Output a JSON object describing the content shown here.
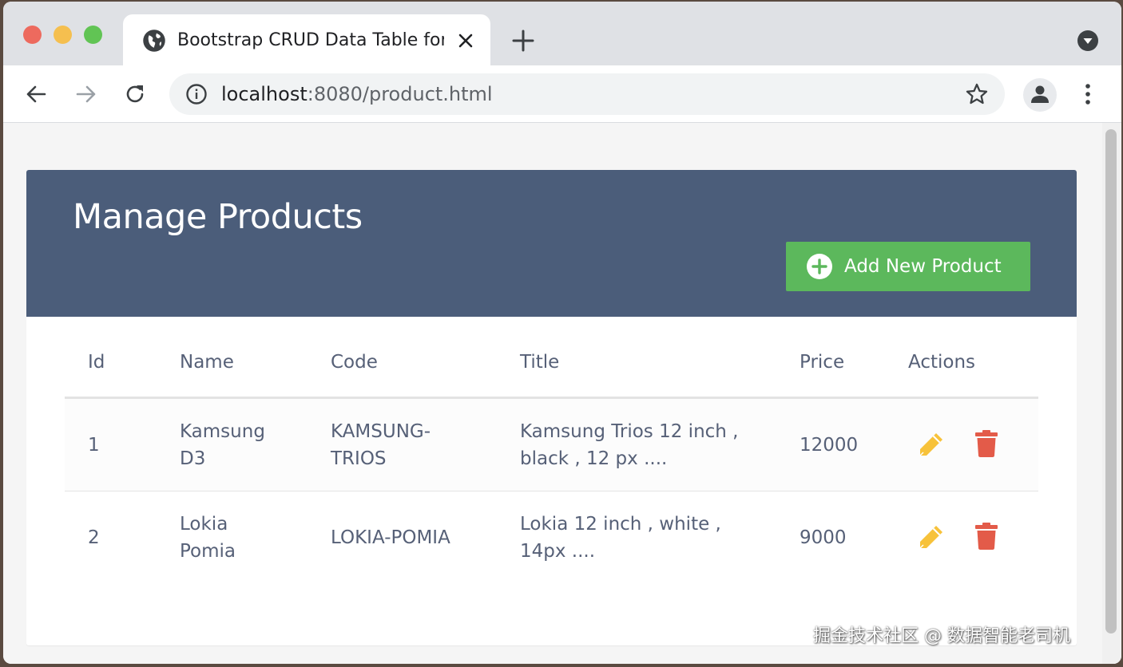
{
  "browser": {
    "tab": {
      "title": "Bootstrap CRUD Data Table for Database"
    },
    "url": {
      "host": "localhost",
      "rest": ":8080/product.html"
    },
    "icons": {
      "globe": "globe-icon",
      "close": "close-icon",
      "new_tab": "plus-icon",
      "tab_menu": "chevron-down-icon",
      "back": "arrow-left-icon",
      "forward": "arrow-right-icon",
      "reload": "reload-icon",
      "site_info": "info-icon",
      "bookmark": "star-icon",
      "profile": "user-icon",
      "menu": "kebab-icon"
    }
  },
  "page": {
    "title": "Manage Products",
    "add_button": {
      "label": "Add New Product"
    },
    "table": {
      "columns": [
        "Id",
        "Name",
        "Code",
        "Title",
        "Price",
        "Actions"
      ],
      "rows": [
        {
          "id": "1",
          "name_line1": "Kamsung",
          "name_line2": "D3",
          "code_line1": "KAMSUNG-",
          "code_line2": "TRIOS",
          "title_line1": "Kamsung Trios 12 inch ,",
          "title_line2": "black , 12 px ....",
          "price": "12000"
        },
        {
          "id": "2",
          "name_line1": "Lokia",
          "name_line2": "Pomia",
          "code": "LOKIA-POMIA",
          "title_line1": "Lokia 12 inch , white ,",
          "title_line2": "14px ....",
          "price": "9000"
        }
      ]
    }
  },
  "watermark": "掘金技术社区 @ 数据智能老司机",
  "colors": {
    "header_bg": "#4b5d7a",
    "add_button_bg": "#5cb85c",
    "edit_icon": "#f7c23a",
    "delete_icon": "#e35b49",
    "text": "#566077"
  }
}
